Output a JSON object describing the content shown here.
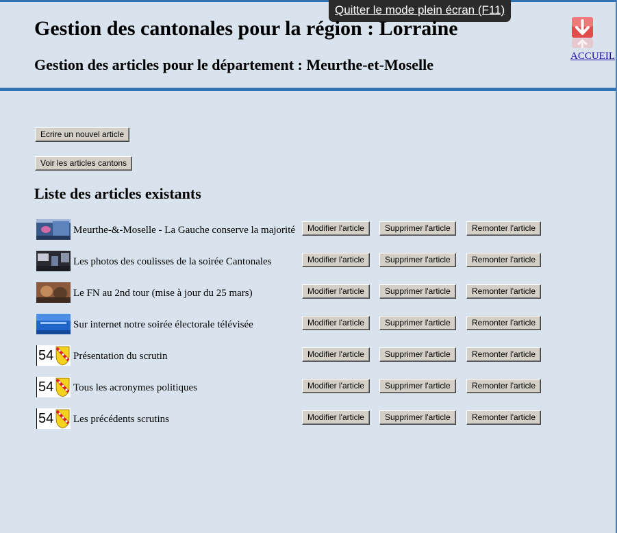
{
  "fullscreen_tooltip": "Quitter le mode plein écran (F11)",
  "header": {
    "title": "Gestion des cantonales pour la région : Lorraine",
    "subtitle": "Gestion des articles pour le département : Meurthe-et-Moselle",
    "home_link": "ACCUEIL"
  },
  "actions": {
    "write_label": "Ecrire un nouvel article",
    "view_cantons_label": "Voir les articles cantons"
  },
  "list": {
    "heading": "Liste des articles existants",
    "edit_label": "Modifier l'article",
    "delete_label": "Supprimer l'article",
    "raise_label": "Remonter l'article",
    "articles": [
      {
        "title": "Meurthe-&-Moselle - La Gauche conserve la majorité",
        "thumb": "tv-studio-screen"
      },
      {
        "title": "Les photos des coulisses de la soirée Cantonales",
        "thumb": "backstage-photo"
      },
      {
        "title": "Le FN au 2nd tour (mise à jour du 25 mars)",
        "thumb": "meeting-photo"
      },
      {
        "title": "Sur internet notre soirée électorale télévisée",
        "thumb": "tv-studio-blue"
      },
      {
        "title": "Présentation du scrutin",
        "thumb": "54-coat-of-arms",
        "badge": "54"
      },
      {
        "title": "Tous les acronymes politiques",
        "thumb": "54-coat-of-arms",
        "badge": "54"
      },
      {
        "title": "Les précédents scrutins",
        "thumb": "54-coat-of-arms",
        "badge": "54"
      }
    ]
  },
  "colors": {
    "background": "#d8e3ed",
    "rule": "#2f73b5",
    "button_face": "#d4d0c8",
    "link": "#1a0dab",
    "home_icon": "#e34c4c"
  }
}
